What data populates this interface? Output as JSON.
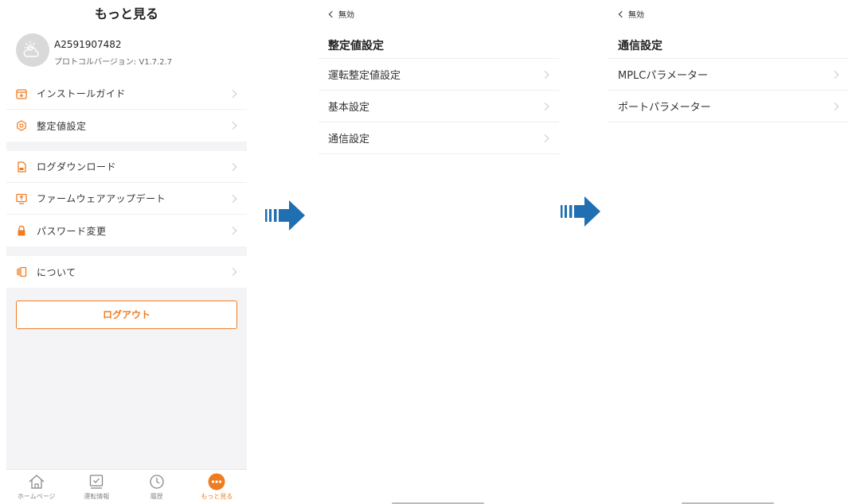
{
  "screen1": {
    "title": "もっと見る",
    "user_id": "A2591907482",
    "protocol_version": "プロトコルバージョン: V1.7.2.7",
    "menu_group1": [
      {
        "label": "インストールガイド",
        "icon": "install-guide-icon"
      },
      {
        "label": "整定値設定",
        "icon": "settings-gear-icon"
      }
    ],
    "menu_group2": [
      {
        "label": "ログダウンロード",
        "icon": "log-download-icon"
      },
      {
        "label": "ファームウェアアップデート",
        "icon": "firmware-update-icon"
      },
      {
        "label": "パスワード変更",
        "icon": "lock-icon"
      }
    ],
    "menu_group3": [
      {
        "label": "について",
        "icon": "about-icon"
      }
    ],
    "logout_label": "ログアウト",
    "tabs": [
      {
        "label": "ホームページ",
        "icon": "home-icon"
      },
      {
        "label": "運転情報",
        "icon": "checkbox-icon"
      },
      {
        "label": "履歴",
        "icon": "clock-icon"
      },
      {
        "label": "もっと見る",
        "icon": "more-icon",
        "active": true
      }
    ]
  },
  "screen2": {
    "back_label": "無効",
    "title": "整定値設定",
    "items": [
      "運転整定値設定",
      "基本設定",
      "通信設定"
    ]
  },
  "screen3": {
    "back_label": "無効",
    "title": "通信設定",
    "items": [
      "MPLCパラメーター",
      "ポートパラメーター"
    ]
  },
  "colors": {
    "accent": "#f07c21",
    "arrow": "#1f6fb2"
  }
}
